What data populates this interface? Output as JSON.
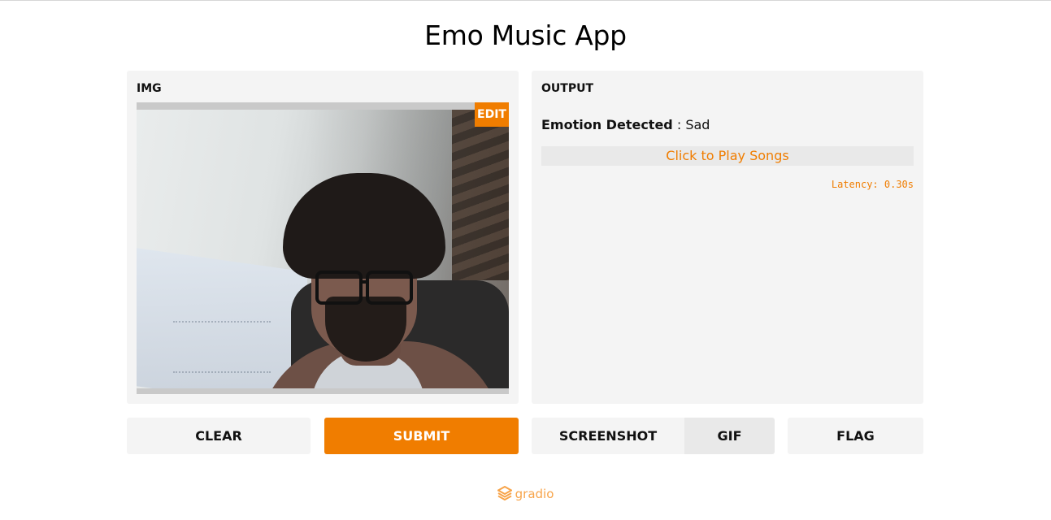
{
  "app": {
    "title": "Emo Music App"
  },
  "input_panel": {
    "label": "IMG",
    "edit_label": "EDIT"
  },
  "output_panel": {
    "label": "OUTPUT",
    "emotion_label": "Emotion Detected",
    "separator": " : ",
    "emotion_value": "Sad",
    "play_link": "Click to Play Songs",
    "latency": "Latency: 0.30s"
  },
  "buttons": {
    "clear": "CLEAR",
    "submit": "SUBMIT",
    "screenshot": "SCREENSHOT",
    "gif": "GIF",
    "flag": "FLAG"
  },
  "footer": {
    "brand": "gradio",
    "icon": "gradio-logo-icon"
  },
  "colors": {
    "accent": "#f07d00",
    "panel_bg": "#f4f4f4",
    "footer_text": "#f7a44a"
  }
}
